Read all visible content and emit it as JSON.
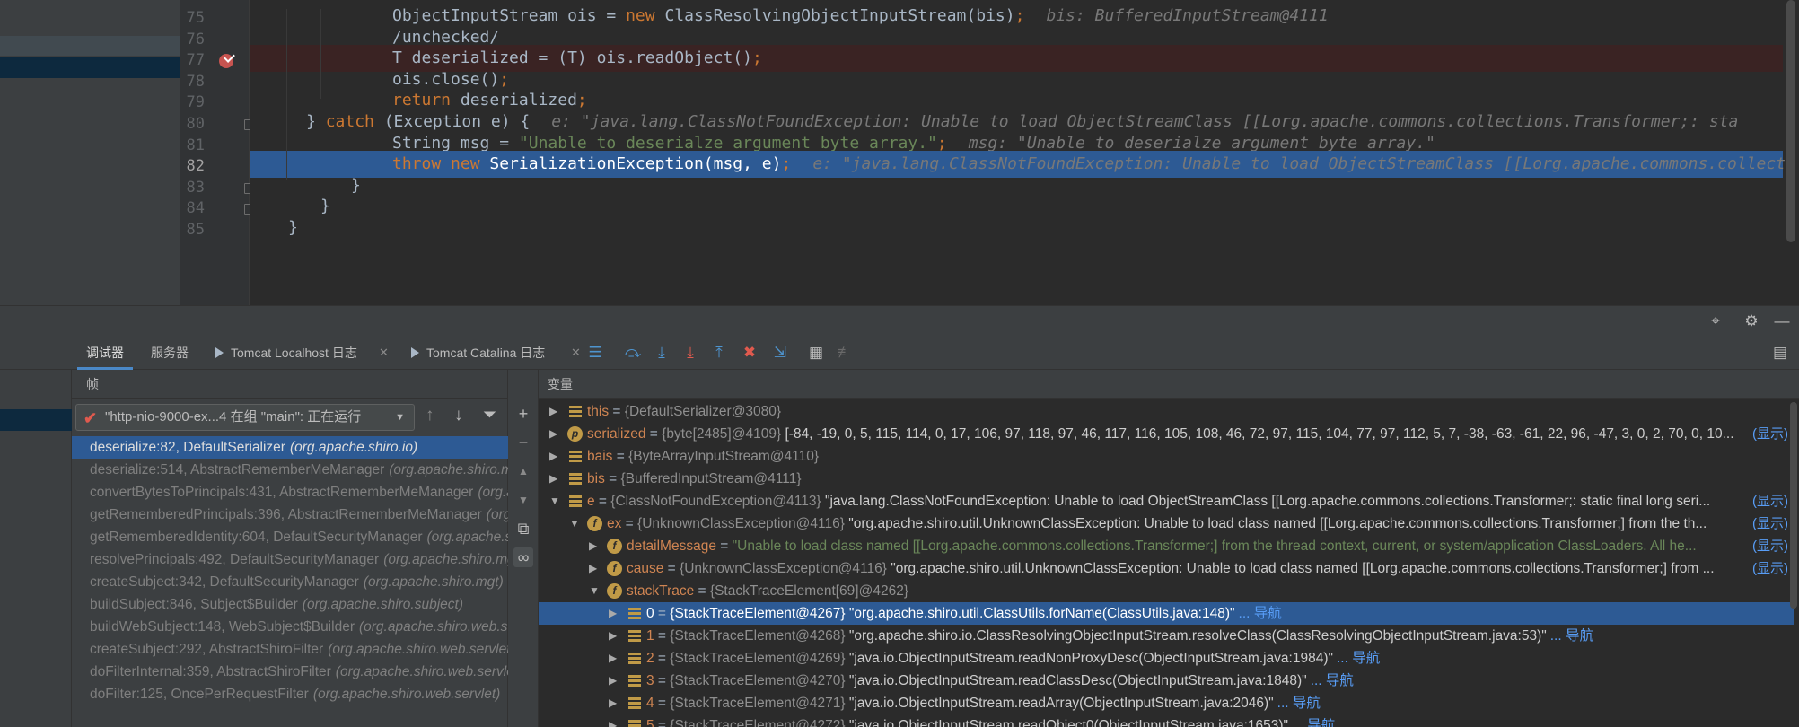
{
  "editor": {
    "lines": [
      {
        "num": "75",
        "segs": [
          {
            "t": "ObjectInputStream ois = ",
            "c": ""
          },
          {
            "t": "new ",
            "c": "kw"
          },
          {
            "t": "ClassResolvingObjectInputStream(bis)",
            "c": ""
          },
          {
            "t": ";",
            "c": "kw"
          }
        ],
        "hint": "bis: BufferedInputStream@4111"
      },
      {
        "num": "76",
        "segs": [
          {
            "t": "/unchecked/",
            "c": ""
          }
        ],
        "hint": ""
      },
      {
        "num": "77",
        "segs": [
          {
            "t": "T deserialized = (T) ois.readObject()",
            "c": ""
          },
          {
            "t": ";",
            "c": "kw"
          }
        ],
        "hint": ""
      },
      {
        "num": "78",
        "segs": [
          {
            "t": "ois.close()",
            "c": ""
          },
          {
            "t": ";",
            "c": "kw"
          }
        ],
        "hint": ""
      },
      {
        "num": "79",
        "segs": [
          {
            "t": "return ",
            "c": "kw"
          },
          {
            "t": "deserialized",
            "c": ""
          },
          {
            "t": ";",
            "c": "kw"
          }
        ],
        "hint": ""
      },
      {
        "num": "80",
        "segs": [
          {
            "t": "} ",
            "c": ""
          },
          {
            "t": "catch ",
            "c": "kw"
          },
          {
            "t": "(Exception e) {",
            "c": ""
          }
        ],
        "hint": "e: \"java.lang.ClassNotFoundException: Unable to load ObjectStreamClass [[Lorg.apache.commons.collections.Transformer;: sta"
      },
      {
        "num": "81",
        "segs": [
          {
            "t": "String msg = ",
            "c": ""
          },
          {
            "t": "\"Unable to deserialze argument byte array.\"",
            "c": "str"
          },
          {
            "t": ";",
            "c": "kw"
          }
        ],
        "hint": "msg: \"Unable to deserialze argument byte array.\""
      },
      {
        "num": "82",
        "segs": [
          {
            "t": "throw new ",
            "c": "kw"
          },
          {
            "t": "SerializationException(msg, e)",
            "c": ""
          },
          {
            "t": ";",
            "c": "kw"
          }
        ],
        "hint": "e: \"java.lang.ClassNotFoundException: Unable to load ObjectStreamClass [[Lorg.apache.commons.collect"
      },
      {
        "num": "83",
        "segs": [
          {
            "t": "}",
            "c": ""
          }
        ],
        "hint": ""
      },
      {
        "num": "84",
        "segs": [
          {
            "t": "}",
            "c": ""
          }
        ],
        "hint": ""
      },
      {
        "num": "85",
        "segs": [
          {
            "t": "}",
            "c": ""
          }
        ],
        "hint": ""
      }
    ],
    "breakpoint_line": "77",
    "current_line": "82"
  },
  "debug": {
    "tabs": [
      {
        "label": "调试器",
        "active": true
      },
      {
        "label": "服务器",
        "active": false
      },
      {
        "label": "Tomcat Localhost 日志",
        "active": false
      },
      {
        "label": "Tomcat Catalina 日志",
        "active": false
      }
    ],
    "frames_header": "帧",
    "vars_header": "变量",
    "thread": "\"http-nio-9000-ex...4 在组 \"main\": 正在运行",
    "frames": [
      {
        "method": "deserialize:82, DefaultSerializer",
        "pkg": "(org.apache.shiro.io)"
      },
      {
        "method": "deserialize:514, AbstractRememberMeManager",
        "pkg": "(org.apache.shiro.mgt)"
      },
      {
        "method": "convertBytesToPrincipals:431, AbstractRememberMeManager",
        "pkg": "(org.apache.shiro.mgt)"
      },
      {
        "method": "getRememberedPrincipals:396, AbstractRememberMeManager",
        "pkg": "(org.apache.shiro.mgt)"
      },
      {
        "method": "getRememberedIdentity:604, DefaultSecurityManager",
        "pkg": "(org.apache.shiro.mgt)"
      },
      {
        "method": "resolvePrincipals:492, DefaultSecurityManager",
        "pkg": "(org.apache.shiro.mgt)"
      },
      {
        "method": "createSubject:342, DefaultSecurityManager",
        "pkg": "(org.apache.shiro.mgt)"
      },
      {
        "method": "buildSubject:846, Subject$Builder",
        "pkg": "(org.apache.shiro.subject)"
      },
      {
        "method": "buildWebSubject:148, WebSubject$Builder",
        "pkg": "(org.apache.shiro.web.subject)"
      },
      {
        "method": "createSubject:292, AbstractShiroFilter",
        "pkg": "(org.apache.shiro.web.servlet)"
      },
      {
        "method": "doFilterInternal:359, AbstractShiroFilter",
        "pkg": "(org.apache.shiro.web.servlet)"
      },
      {
        "method": "doFilter:125, OncePerRequestFilter",
        "pkg": "(org.apache.shiro.web.servlet)"
      }
    ],
    "variables": [
      {
        "depth": 0,
        "expanded": false,
        "icon": "list",
        "name": "this",
        "type": "{DefaultSerializer@3080}",
        "value": "",
        "nav": "",
        "show": false
      },
      {
        "depth": 0,
        "expanded": false,
        "icon": "p",
        "name": "serialized",
        "type": "{byte[2485]@4109}",
        "value": "[-84, -19, 0, 5, 115, 114, 0, 17, 106, 97, 118, 97, 46, 117, 116, 105, 108, 46, 72, 97, 115, 104, 77, 97, 112, 5, 7, -38, -63, -61, 22, 96, -47, 3, 0, 2, 70, 0, 10...",
        "nav": "",
        "show": true
      },
      {
        "depth": 0,
        "expanded": false,
        "icon": "list",
        "name": "bais",
        "type": "{ByteArrayInputStream@4110}",
        "value": "",
        "nav": "",
        "show": false
      },
      {
        "depth": 0,
        "expanded": false,
        "icon": "list",
        "name": "bis",
        "type": "{BufferedInputStream@4111}",
        "value": "",
        "nav": "",
        "show": false
      },
      {
        "depth": 0,
        "expanded": true,
        "icon": "list",
        "name": "e",
        "type": "{ClassNotFoundException@4113}",
        "value": "\"java.lang.ClassNotFoundException: Unable to load ObjectStreamClass [[Lorg.apache.commons.collections.Transformer;: static final long seri...",
        "nav": "",
        "show": true
      },
      {
        "depth": 1,
        "expanded": true,
        "icon": "f",
        "name": "ex",
        "type": "{UnknownClassException@4116}",
        "value": "\"org.apache.shiro.util.UnknownClassException: Unable to load class named [[Lorg.apache.commons.collections.Transformer;] from the th...",
        "nav": "",
        "show": true
      },
      {
        "depth": 2,
        "expanded": false,
        "icon": "f",
        "name": "detailMessage",
        "type": "",
        "value": "\"Unable to load class named [[Lorg.apache.commons.collections.Transformer;] from the thread context, current, or system/application ClassLoaders.  All he...",
        "nav": "",
        "show": true,
        "str": true
      },
      {
        "depth": 2,
        "expanded": false,
        "icon": "f",
        "name": "cause",
        "type": "{UnknownClassException@4116}",
        "value": "\"org.apache.shiro.util.UnknownClassException: Unable to load class named [[Lorg.apache.commons.collections.Transformer;] from ...",
        "nav": "",
        "show": true
      },
      {
        "depth": 2,
        "expanded": true,
        "icon": "f",
        "name": "stackTrace",
        "type": "{StackTraceElement[69]@4262}",
        "value": "",
        "nav": "",
        "show": false
      },
      {
        "depth": 3,
        "expanded": false,
        "icon": "list",
        "name": "0",
        "type": "{StackTraceElement@4267}",
        "value": "\"org.apache.shiro.util.ClassUtils.forName(ClassUtils.java:148)\"",
        "nav": "... 导航",
        "show": false,
        "selected": true
      },
      {
        "depth": 3,
        "expanded": false,
        "icon": "list",
        "name": "1",
        "type": "{StackTraceElement@4268}",
        "value": "\"org.apache.shiro.io.ClassResolvingObjectInputStream.resolveClass(ClassResolvingObjectInputStream.java:53)\"",
        "nav": "... 导航",
        "show": false
      },
      {
        "depth": 3,
        "expanded": false,
        "icon": "list",
        "name": "2",
        "type": "{StackTraceElement@4269}",
        "value": "\"java.io.ObjectInputStream.readNonProxyDesc(ObjectInputStream.java:1984)\"",
        "nav": "... 导航",
        "show": false
      },
      {
        "depth": 3,
        "expanded": false,
        "icon": "list",
        "name": "3",
        "type": "{StackTraceElement@4270}",
        "value": "\"java.io.ObjectInputStream.readClassDesc(ObjectInputStream.java:1848)\"",
        "nav": "... 导航",
        "show": false
      },
      {
        "depth": 3,
        "expanded": false,
        "icon": "list",
        "name": "4",
        "type": "{StackTraceElement@4271}",
        "value": "\"java.io.ObjectInputStream.readArray(ObjectInputStream.java:2046)\"",
        "nav": "... 导航",
        "show": false
      },
      {
        "depth": 3,
        "expanded": false,
        "icon": "list",
        "name": "5",
        "type": "{StackTraceElement@4272}",
        "value": "\"java.io.ObjectInputStream.readObject0(ObjectInputStream.java:1653)\"",
        "nav": "... 导航",
        "show": false
      }
    ],
    "show_label": "(显示)"
  }
}
